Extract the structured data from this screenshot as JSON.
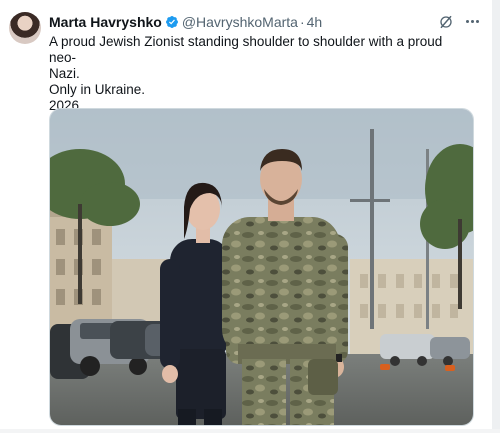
{
  "author": {
    "display_name": "Marta Havryshko",
    "handle": "@HavryshkoMarta",
    "separator": "·",
    "time": "4h",
    "verified": true
  },
  "text_lines": [
    "A proud Jewish Zionist standing shoulder to shoulder with a proud neo-",
    "Nazi.",
    "Only in Ukraine.",
    "2026."
  ],
  "icons": {
    "avatar": "avatar-photo",
    "verified": "verified-badge-icon",
    "grok": "grok-icon",
    "more": "more-icon"
  },
  "colors": {
    "text": "#0f1419",
    "secondary": "#536471",
    "verified": "#1d9bf0"
  }
}
